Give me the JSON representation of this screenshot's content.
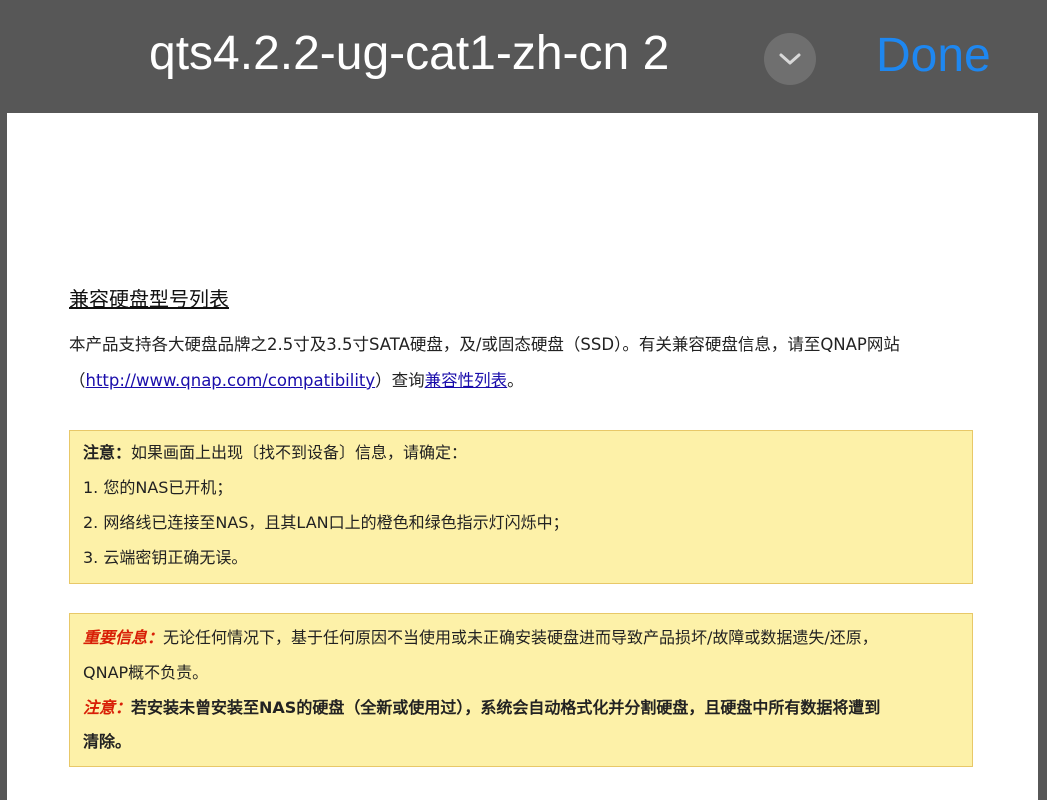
{
  "nav": {
    "title": "qts4.2.2-ug-cat1-zh-cn 2",
    "done_label": "Done"
  },
  "doc": {
    "heading": "兼容硬盘型号列表",
    "intro_line1": "本产品支持各大硬盘品牌之2.5寸及3.5寸SATA硬盘，及/或固态硬盘（SSD）。有关兼容硬盘信息，请至QNAP网站",
    "intro_line2_prefix": "（",
    "compat_url": "http://www.qnap.com/compatibility",
    "intro_line2_mid": "）查询",
    "compat_list_link": "兼容性列表",
    "intro_line2_suffix": "。",
    "note_box": {
      "label": "注意：",
      "text": "如果画面上出现〔找不到设备〕信息，请确定：",
      "items": [
        "1. 您的NAS已开机；",
        "2. 网络线已连接至NAS，且其LAN口上的橙色和绿色指示灯闪烁中；",
        "3. 云端密钥正确无误。"
      ]
    },
    "important_box": {
      "important_label": "重要信息：",
      "important_text": "无论任何情况下，基于任何原因不当使用或未正确安装硬盘进而导致产品损坏/故障或数据遗失/还原，",
      "important_text2": "QNAP概不负责。",
      "note_label": "注意：",
      "note_text": "若安装未曾安装至NAS的硬盘（全新或使用过），系统会自动格式化并分割硬盘，且硬盘中所有数据将遭到",
      "note_text2": "清除。"
    }
  }
}
